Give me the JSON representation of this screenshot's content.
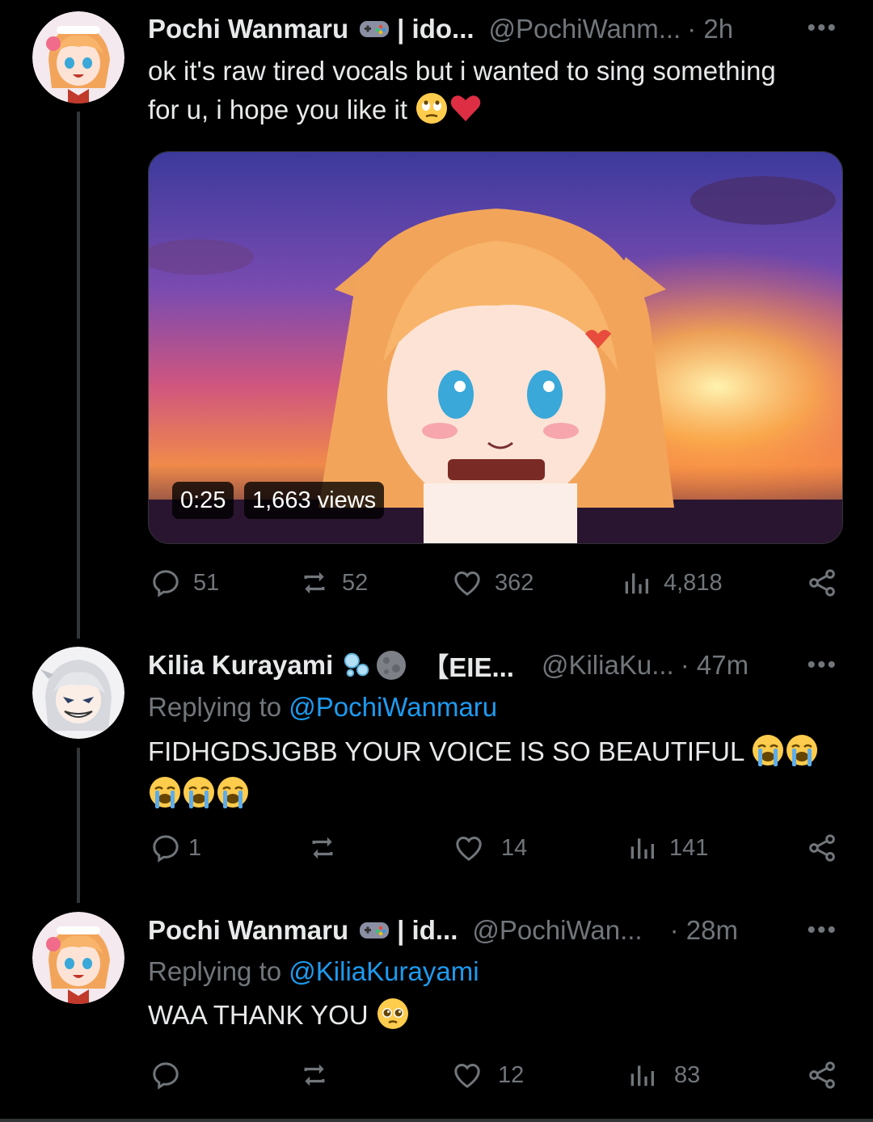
{
  "tweets": [
    {
      "name": "Pochi Wanmaru",
      "name_suffix": "| ido...",
      "handle": "@PochiWanm...",
      "time": "· 2h",
      "text_line1": "ok it's raw tired vocals but i wanted to sing something",
      "text_line2": "for u, i hope you like it",
      "video": {
        "duration": "0:25",
        "views": "1,663 views"
      },
      "replies": "51",
      "reposts": "52",
      "likes": "362",
      "views": "4,818"
    },
    {
      "name": "Kilia Kurayami",
      "name_suffix": "【EIE...",
      "handle": "@KiliaKu...",
      "time": "· 47m",
      "replying_prefix": "Replying to",
      "replying_handle": "@PochiWanmaru",
      "text": "FIDHGDSJGBB YOUR VOICE IS SO BEAUTIFUL",
      "replies": "1",
      "reposts": "",
      "likes": "14",
      "views": "141"
    },
    {
      "name": "Pochi Wanmaru",
      "name_suffix": "| id...",
      "handle": "@PochiWan...",
      "time": "· 28m",
      "replying_prefix": "Replying to",
      "replying_handle": "@KiliaKurayami",
      "text": "WAA THANK YOU",
      "replies": "",
      "reposts": "",
      "likes": "12",
      "views": "83"
    }
  ],
  "more_label": "•••",
  "colors": {
    "background": "#000000",
    "text": "#e7e9ea",
    "muted": "#71767b",
    "link": "#1d9bf0",
    "heart": "#f4212e"
  }
}
